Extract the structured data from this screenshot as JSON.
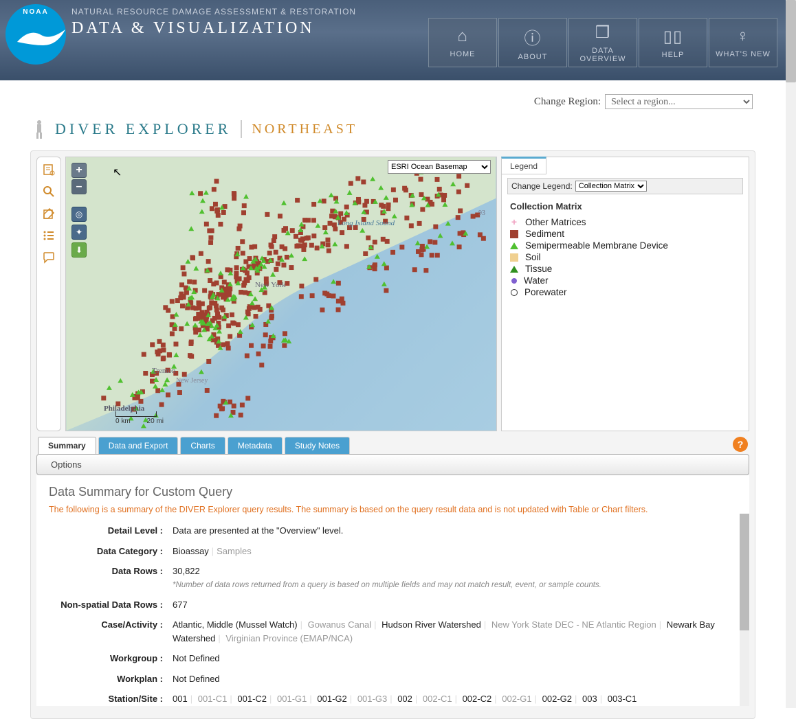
{
  "header": {
    "tag": "NATURAL RESOURCE DAMAGE ASSESSMENT & RESTORATION",
    "title": "DATA & VISUALIZATION",
    "logo_alt": "NOAA"
  },
  "nav": {
    "home": "HOME",
    "about": "ABOUT",
    "dataoverview": "DATA OVERVIEW",
    "help": "HELP",
    "whatsnew": "WHAT'S NEW"
  },
  "region": {
    "label": "Change Region:",
    "placeholder": "Select a region..."
  },
  "page_title": {
    "main": "DIVER EXPLORER",
    "sub": "NORTHEAST"
  },
  "map": {
    "basemap_selected": "ESRI Ocean Basemap",
    "zoom_in": "+",
    "zoom_out": "–",
    "scale_km": "0 km",
    "scale_mi": "20 mi",
    "labels": {
      "lis": "Long Island Sound",
      "ny": "New York",
      "trenton": "Trenton",
      "nj": "New Jersey",
      "phila": "Philadelphia",
      "rt93": "93"
    }
  },
  "legend": {
    "tab": "Legend",
    "change_label": "Change Legend:",
    "change_selected": "Collection Matrix",
    "heading": "Collection Matrix",
    "items": [
      {
        "sym": "plus",
        "label": "Other Matrices"
      },
      {
        "sym": "square",
        "label": "Sediment"
      },
      {
        "sym": "tri",
        "label": "Semipermeable Membrane Device"
      },
      {
        "sym": "soil",
        "label": "Soil"
      },
      {
        "sym": "tri2",
        "label": "Tissue"
      },
      {
        "sym": "dot",
        "label": "Water"
      },
      {
        "sym": "circle",
        "label": "Porewater"
      }
    ]
  },
  "tabs": {
    "summary": "Summary",
    "data_export": "Data and Export",
    "charts": "Charts",
    "metadata": "Metadata",
    "study_notes": "Study Notes"
  },
  "options_label": "Options",
  "summary": {
    "title": "Data Summary for Custom Query",
    "note": "The following is a summary of the DIVER Explorer query results. The summary is based on the query result data and is not updated with Table or Chart filters.",
    "rows": {
      "detail_level_label": "Detail Level :",
      "detail_level_value": "Data are presented at the \"Overview\" level.",
      "data_category_label": "Data Category :",
      "data_category_v1": "Bioassay",
      "data_category_v2": "Samples",
      "data_rows_label": "Data Rows :",
      "data_rows_value": "30,822",
      "data_rows_footnote": "*Number of data rows returned from a query is based on multiple fields and may not match result, event, or sample counts.",
      "nonspatial_label": "Non-spatial Data Rows :",
      "nonspatial_value": "677",
      "case_label": "Case/Activity :",
      "case_v1": "Atlantic, Middle (Mussel Watch)",
      "case_v2": "Gowanus Canal",
      "case_v3": "Hudson River Watershed",
      "case_v4": "New York State DEC - NE Atlantic Region",
      "case_v5": "Newark Bay Watershed",
      "case_v6": "Virginian Province (EMAP/NCA)",
      "workgroup_label": "Workgroup :",
      "workgroup_value": "Not Defined",
      "workplan_label": "Workplan :",
      "workplan_value": "Not Defined",
      "station_label": "Station/Site :",
      "station_v1": "001",
      "station_v2": "001-C1",
      "station_v3": "001-C2",
      "station_v4": "001-G1",
      "station_v5": "001-G2",
      "station_v6": "001-G3",
      "station_v7": "002",
      "station_v8": "002-C1",
      "station_v9": "002-C2",
      "station_v10": "002-G1",
      "station_v11": "002-G2",
      "station_v12": "003",
      "station_v13": "003-C1"
    }
  }
}
